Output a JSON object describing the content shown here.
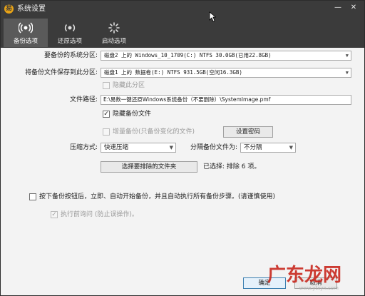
{
  "window": {
    "title": "系统设置",
    "minimize": "—",
    "close": "✕"
  },
  "tabs": [
    {
      "label": "备份选项",
      "icon": "radio-waves-icon",
      "active": true
    },
    {
      "label": "还原选项",
      "icon": "radio-waves-icon",
      "active": false
    },
    {
      "label": "启动选项",
      "icon": "spinner-icon",
      "active": false
    }
  ],
  "form": {
    "system_partition_label": "要备份的系统分区:",
    "system_partition_value": "磁盘2 上的 Windows_10_1709(C:) NTFS 30.0GB(已用22.8GB)",
    "save_partition_label": "将备份文件保存到此分区:",
    "save_partition_value": "磁盘1 上的 数据卷(E:) NTFS 931.5GB(空闲16.3GB)",
    "hide_partition_label": "隐藏此分区",
    "file_path_label": "文件路径:",
    "file_path_value": "E:\\易数一键还原Windows系统备份（不要删除）\\SystemImage.pmf",
    "hide_file_label": "隐藏备份文件",
    "incremental_label": "增量备份(只备份变化的文件)",
    "set_password_button": "设置密码",
    "compression_label": "压缩方式:",
    "compression_value": "快速压缩",
    "split_label": "分隔备份文件为:",
    "split_value": "不分隔",
    "exclude_button": "选择要排除的文件夹",
    "selected_text": "已选择: 排除 6 项。",
    "auto_backup_label": "按下备份按钮后，立即、自动开始备份，并且自动执行所有备份步骤。(请谨慎使用)",
    "confirm_before_label": "执行前询问 (防止误操作)。"
  },
  "footer": {
    "ok_button": "确定",
    "cancel_button": "取消"
  },
  "watermark": {
    "text": "广东龙网",
    "sub": "www.ytxyn.com"
  }
}
